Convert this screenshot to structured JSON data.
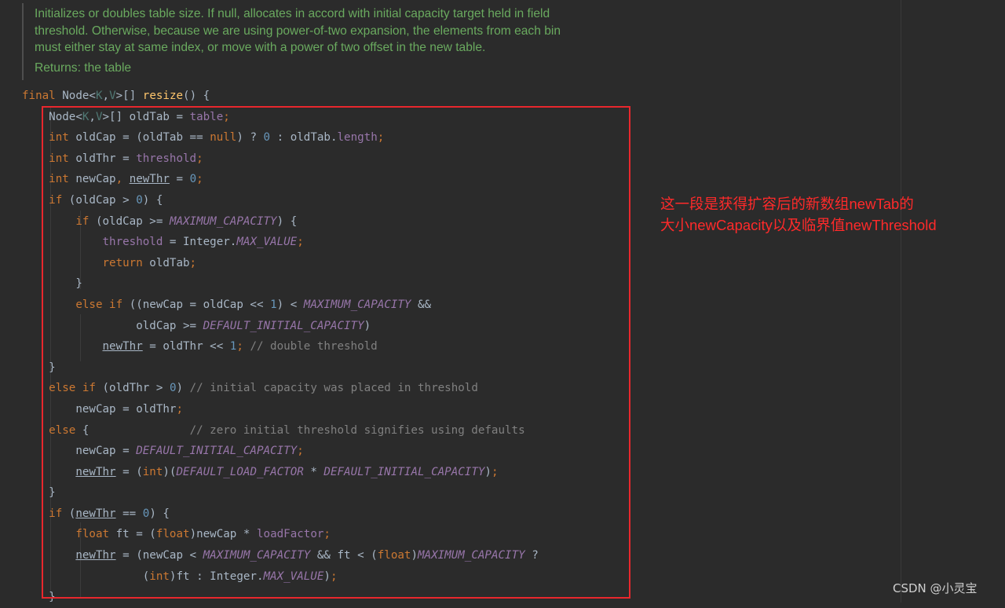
{
  "doc": {
    "lines": [
      "Initializes or doubles table size. If null, allocates in accord with initial capacity target held in field",
      "threshold. Otherwise, because we are using power-of-two expansion, the elements from each bin",
      "must either stay at same index, or move with a power of two offset in the new table."
    ],
    "returns": "Returns: the table"
  },
  "code": {
    "lines": [
      [
        [
          "kw",
          "final "
        ],
        [
          "p",
          "Node<"
        ],
        [
          "gen",
          "K"
        ],
        [
          "p",
          ","
        ],
        [
          "gen",
          "V"
        ],
        [
          "p",
          ">[] "
        ],
        [
          "fn",
          "resize"
        ],
        [
          "p",
          "() {"
        ]
      ],
      [
        [
          "p",
          "    Node<"
        ],
        [
          "gen",
          "K"
        ],
        [
          "p",
          ","
        ],
        [
          "gen",
          "V"
        ],
        [
          "p",
          ">[] oldTab = "
        ],
        [
          "fld",
          "table"
        ],
        [
          "kw",
          ";"
        ]
      ],
      [
        [
          "p",
          "    "
        ],
        [
          "kw",
          "int "
        ],
        [
          "p",
          "oldCap = (oldTab == "
        ],
        [
          "kw",
          "null"
        ],
        [
          "p",
          ") ? "
        ],
        [
          "num",
          "0"
        ],
        [
          "p",
          " : oldTab."
        ],
        [
          "fld",
          "length"
        ],
        [
          "kw",
          ";"
        ]
      ],
      [
        [
          "p",
          "    "
        ],
        [
          "kw",
          "int "
        ],
        [
          "p",
          "oldThr = "
        ],
        [
          "fld",
          "threshold"
        ],
        [
          "kw",
          ";"
        ]
      ],
      [
        [
          "p",
          "    "
        ],
        [
          "kw",
          "int "
        ],
        [
          "p",
          "newCap"
        ],
        [
          "kw",
          ", "
        ],
        [
          "ul",
          "newThr"
        ],
        [
          "p",
          " = "
        ],
        [
          "num",
          "0"
        ],
        [
          "kw",
          ";"
        ]
      ],
      [
        [
          "p",
          "    "
        ],
        [
          "kw",
          "if "
        ],
        [
          "p",
          "(oldCap > "
        ],
        [
          "num",
          "0"
        ],
        [
          "p",
          ") {"
        ]
      ],
      [
        [
          "p",
          "        "
        ],
        [
          "kw",
          "if "
        ],
        [
          "p",
          "(oldCap >= "
        ],
        [
          "cst",
          "MAXIMUM_CAPACITY"
        ],
        [
          "p",
          ") {"
        ]
      ],
      [
        [
          "p",
          "            "
        ],
        [
          "fld",
          "threshold"
        ],
        [
          "p",
          " = Integer."
        ],
        [
          "cst",
          "MAX_VALUE"
        ],
        [
          "kw",
          ";"
        ]
      ],
      [
        [
          "p",
          "            "
        ],
        [
          "kw",
          "return "
        ],
        [
          "p",
          "oldTab"
        ],
        [
          "kw",
          ";"
        ]
      ],
      [
        [
          "p",
          "        }"
        ]
      ],
      [
        [
          "p",
          "        "
        ],
        [
          "kw",
          "else if "
        ],
        [
          "p",
          "((newCap = oldCap << "
        ],
        [
          "num",
          "1"
        ],
        [
          "p",
          ") < "
        ],
        [
          "cst",
          "MAXIMUM_CAPACITY"
        ],
        [
          "p",
          " &&"
        ]
      ],
      [
        [
          "p",
          "                 oldCap >= "
        ],
        [
          "cst",
          "DEFAULT_INITIAL_CAPACITY"
        ],
        [
          "p",
          ")"
        ]
      ],
      [
        [
          "p",
          "            "
        ],
        [
          "ul",
          "newThr"
        ],
        [
          "p",
          " = oldThr << "
        ],
        [
          "num",
          "1"
        ],
        [
          "kw",
          "; "
        ],
        [
          "cmt",
          "// double threshold"
        ]
      ],
      [
        [
          "p",
          "    }"
        ]
      ],
      [
        [
          "p",
          "    "
        ],
        [
          "kw",
          "else if "
        ],
        [
          "p",
          "(oldThr > "
        ],
        [
          "num",
          "0"
        ],
        [
          "p",
          ") "
        ],
        [
          "cmt",
          "// initial capacity was placed in threshold"
        ]
      ],
      [
        [
          "p",
          "        newCap = oldThr"
        ],
        [
          "kw",
          ";"
        ]
      ],
      [
        [
          "p",
          "    "
        ],
        [
          "kw",
          "else "
        ],
        [
          "p",
          "{               "
        ],
        [
          "cmt",
          "// zero initial threshold signifies using defaults"
        ]
      ],
      [
        [
          "p",
          "        newCap = "
        ],
        [
          "cst",
          "DEFAULT_INITIAL_CAPACITY"
        ],
        [
          "kw",
          ";"
        ]
      ],
      [
        [
          "p",
          "        "
        ],
        [
          "ul",
          "newThr"
        ],
        [
          "p",
          " = ("
        ],
        [
          "kw",
          "int"
        ],
        [
          "p",
          ")("
        ],
        [
          "cst",
          "DEFAULT_LOAD_FACTOR"
        ],
        [
          "p",
          " * "
        ],
        [
          "cst",
          "DEFAULT_INITIAL_CAPACITY"
        ],
        [
          "p",
          ")"
        ],
        [
          "kw",
          ";"
        ]
      ],
      [
        [
          "p",
          "    }"
        ]
      ],
      [
        [
          "p",
          "    "
        ],
        [
          "kw",
          "if "
        ],
        [
          "p",
          "("
        ],
        [
          "ul",
          "newThr"
        ],
        [
          "p",
          " == "
        ],
        [
          "num",
          "0"
        ],
        [
          "p",
          ") {"
        ]
      ],
      [
        [
          "p",
          "        "
        ],
        [
          "kw",
          "float "
        ],
        [
          "p",
          "ft = ("
        ],
        [
          "kw",
          "float"
        ],
        [
          "p",
          ")newCap * "
        ],
        [
          "fld",
          "loadFactor"
        ],
        [
          "kw",
          ";"
        ]
      ],
      [
        [
          "p",
          "        "
        ],
        [
          "ul",
          "newThr"
        ],
        [
          "p",
          " = (newCap < "
        ],
        [
          "cst",
          "MAXIMUM_CAPACITY"
        ],
        [
          "p",
          " && ft < ("
        ],
        [
          "kw",
          "float"
        ],
        [
          "p",
          ")"
        ],
        [
          "cst",
          "MAXIMUM_CAPACITY"
        ],
        [
          "p",
          " ?"
        ]
      ],
      [
        [
          "p",
          "                  ("
        ],
        [
          "kw",
          "int"
        ],
        [
          "p",
          ")ft : Integer."
        ],
        [
          "cst",
          "MAX_VALUE"
        ],
        [
          "p",
          ")"
        ],
        [
          "kw",
          ";"
        ]
      ],
      [
        [
          "p",
          "    }"
        ]
      ]
    ]
  },
  "annotation": {
    "line1": "这一段是获得扩容后的新数组newTab的",
    "line2": "大小newCapacity以及临界值newThreshold",
    "color": "#ff2a2a"
  },
  "highlight_box_color": "#e8272d",
  "watermark": "CSDN @小灵宝"
}
